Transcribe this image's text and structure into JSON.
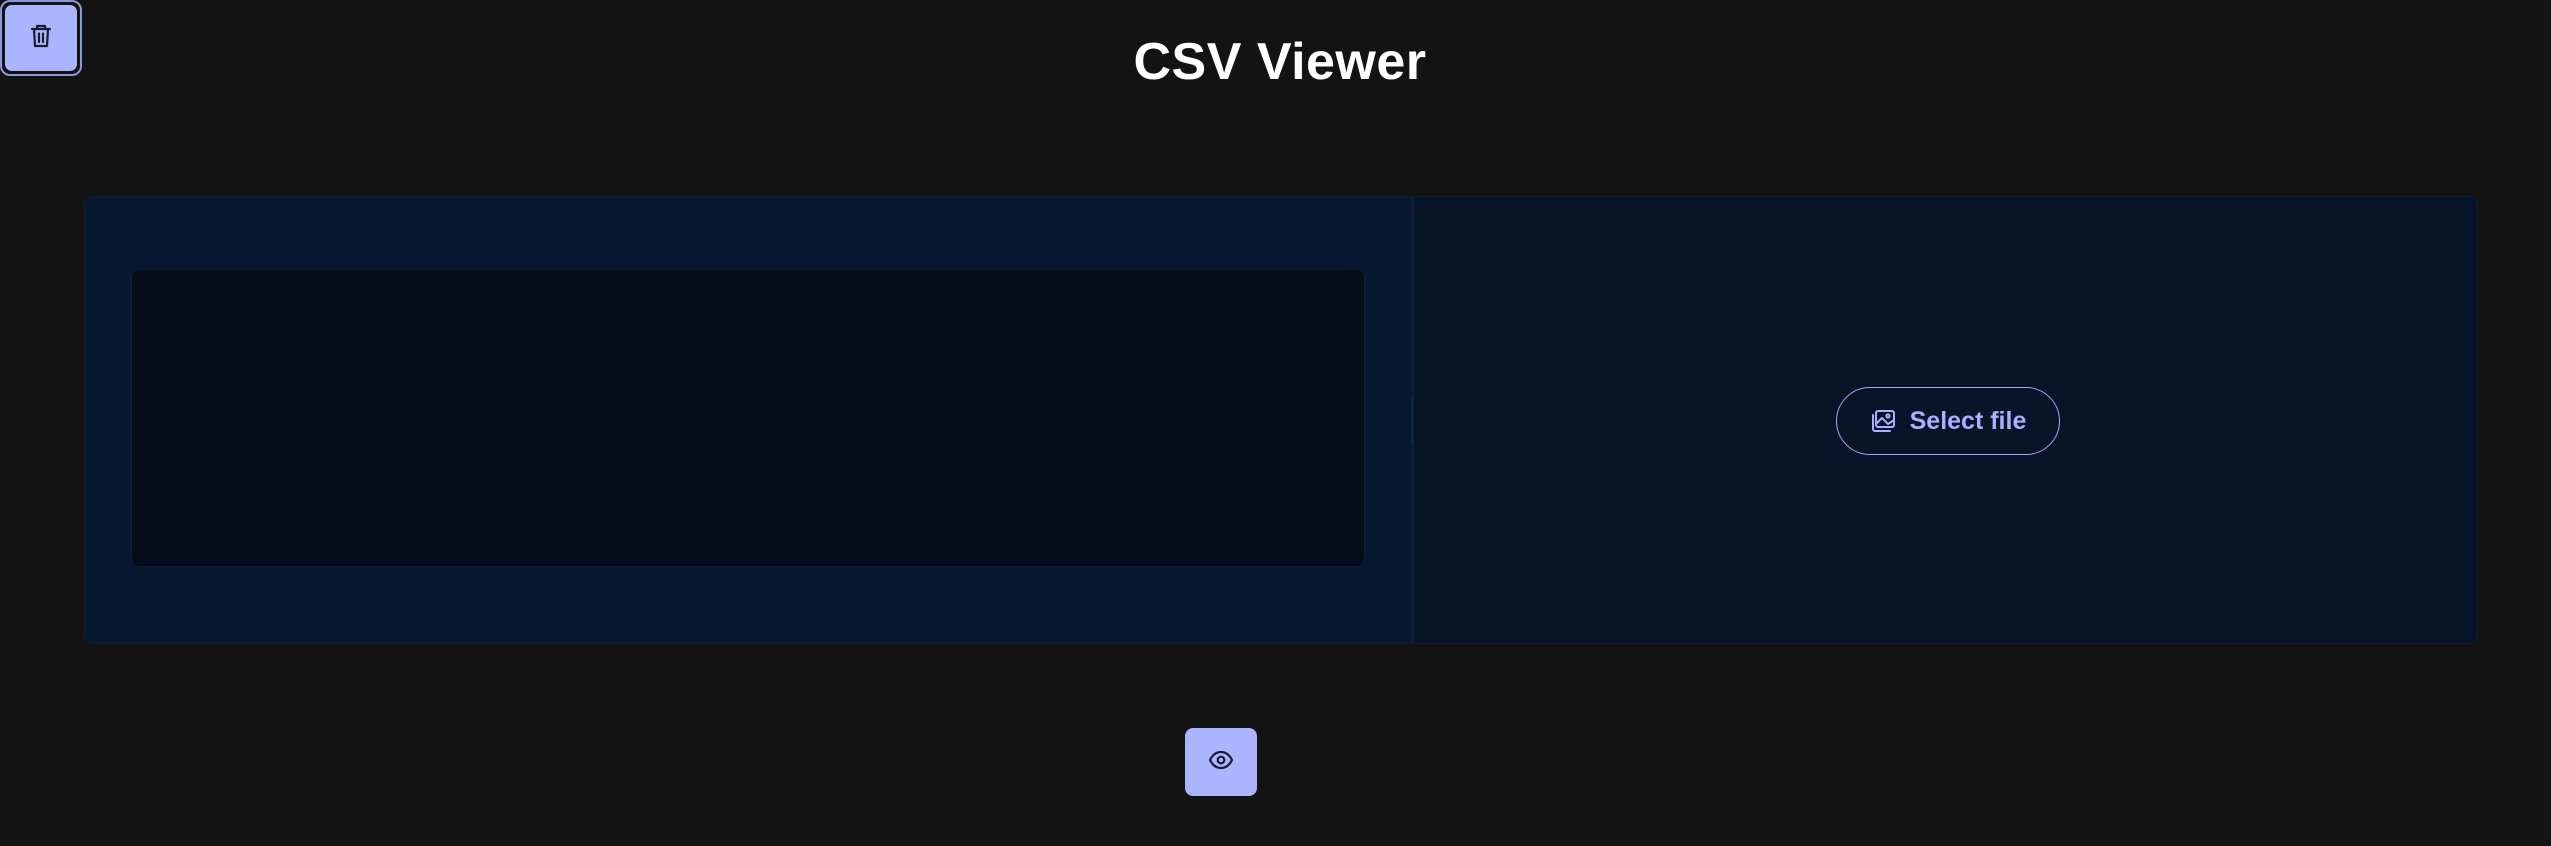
{
  "page": {
    "title": "CSV Viewer"
  },
  "editor": {
    "content": ""
  },
  "upload": {
    "select_label": "Select file",
    "icon": "image-icon"
  },
  "actions": {
    "preview_icon": "eye-icon",
    "delete_icon": "trash-icon"
  },
  "colors": {
    "background": "#131313",
    "panel": "#081427",
    "editor": "#050c19",
    "accent": "#aab4ff",
    "accent_text": "#a9b1ff"
  }
}
